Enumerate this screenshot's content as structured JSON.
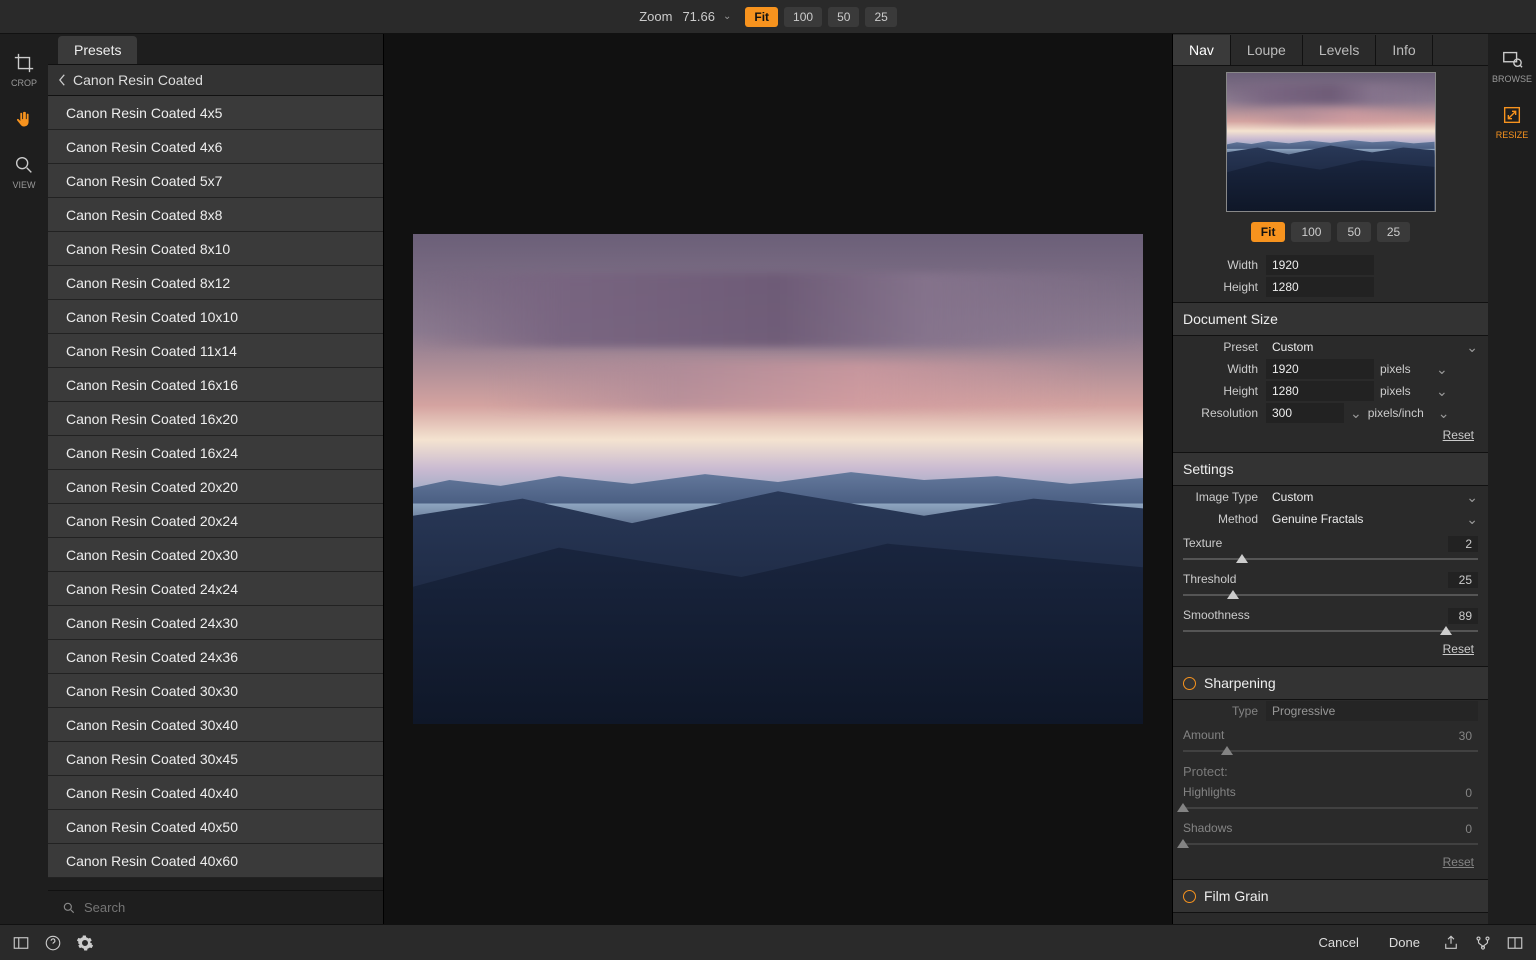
{
  "topbar": {
    "zoom_label": "Zoom",
    "zoom_value": "71.66",
    "buttons": [
      "Fit",
      "100",
      "50",
      "25"
    ],
    "active": "Fit"
  },
  "leftTools": {
    "crop": "CROP",
    "view": "VIEW"
  },
  "presets": {
    "tab": "Presets",
    "header": "Canon Resin Coated",
    "items": [
      "Canon Resin Coated 4x5",
      "Canon Resin Coated 4x6",
      "Canon Resin Coated 5x7",
      "Canon Resin Coated 8x8",
      "Canon Resin Coated 8x10",
      "Canon Resin Coated 8x12",
      "Canon Resin Coated 10x10",
      "Canon Resin Coated 11x14",
      "Canon Resin Coated 16x16",
      "Canon Resin Coated 16x20",
      "Canon Resin Coated 16x24",
      "Canon Resin Coated 20x20",
      "Canon Resin Coated 20x24",
      "Canon Resin Coated 20x30",
      "Canon Resin Coated 24x24",
      "Canon Resin Coated 24x30",
      "Canon Resin Coated 24x36",
      "Canon Resin Coated 30x30",
      "Canon Resin Coated 30x40",
      "Canon Resin Coated 30x45",
      "Canon Resin Coated 40x40",
      "Canon Resin Coated 40x50",
      "Canon Resin Coated 40x60"
    ],
    "search_placeholder": "Search"
  },
  "rightTabs": {
    "items": [
      "Nav",
      "Loupe",
      "Levels",
      "Info"
    ],
    "active": "Nav"
  },
  "navZoom": {
    "buttons": [
      "Fit",
      "100",
      "50",
      "25"
    ],
    "active": "Fit"
  },
  "pixelSize": {
    "width_label": "Width",
    "width": "1920",
    "height_label": "Height",
    "height": "1280"
  },
  "documentSize": {
    "title": "Document Size",
    "preset_label": "Preset",
    "preset": "Custom",
    "width_label": "Width",
    "width": "1920",
    "width_unit": "pixels",
    "height_label": "Height",
    "height": "1280",
    "height_unit": "pixels",
    "resolution_label": "Resolution",
    "resolution": "300",
    "resolution_unit": "pixels/inch",
    "reset": "Reset"
  },
  "settings": {
    "title": "Settings",
    "image_type_label": "Image Type",
    "image_type": "Custom",
    "method_label": "Method",
    "method": "Genuine Fractals",
    "texture_label": "Texture",
    "texture": "2",
    "texture_pct": 20,
    "threshold_label": "Threshold",
    "threshold": "25",
    "threshold_pct": 17,
    "smoothness_label": "Smoothness",
    "smoothness": "89",
    "smoothness_pct": 89,
    "reset": "Reset"
  },
  "sharpening": {
    "title": "Sharpening",
    "type_label": "Type",
    "type": "Progressive",
    "amount_label": "Amount",
    "amount": "30",
    "amount_pct": 15,
    "protect_label": "Protect:",
    "highlights_label": "Highlights",
    "highlights": "0",
    "highlights_pct": 0,
    "shadows_label": "Shadows",
    "shadows": "0",
    "shadows_pct": 0,
    "reset": "Reset"
  },
  "filmGrain": {
    "title": "Film Grain"
  },
  "rightTools": {
    "browse": "BROWSE",
    "resize": "RESIZE"
  },
  "bottombar": {
    "cancel": "Cancel",
    "done": "Done"
  }
}
